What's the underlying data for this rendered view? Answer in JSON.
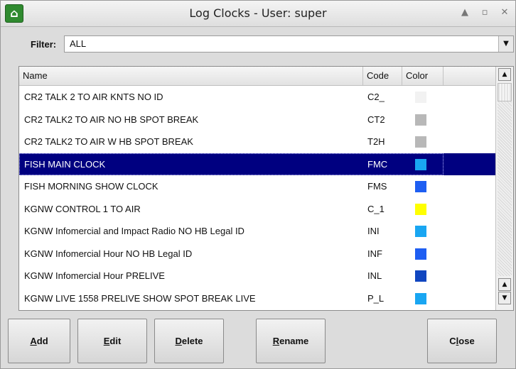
{
  "window": {
    "title": "Log Clocks - User: super"
  },
  "filter": {
    "label": "Filter:",
    "value": "ALL"
  },
  "columns": {
    "name": "Name",
    "code": "Code",
    "color": "Color"
  },
  "rows": [
    {
      "name": "CR2 TALK 2 TO AIR KNTS  NO ID",
      "code": "C2_",
      "color": "#f2f2f2"
    },
    {
      "name": "CR2 TALK2 TO AIR NO HB SPOT BREAK",
      "code": "CT2",
      "color": "#b8b8b8"
    },
    {
      "name": "CR2 TALK2 TO AIR W HB SPOT BREAK",
      "code": "T2H",
      "color": "#b8b8b8"
    },
    {
      "name": "FISH MAIN CLOCK",
      "code": "FMC",
      "color": "#19a6f2",
      "selected": true
    },
    {
      "name": "FISH MORNING SHOW CLOCK",
      "code": "FMS",
      "color": "#1e5ef2"
    },
    {
      "name": "KGNW   CONTROL 1 TO AIR",
      "code": "C_1",
      "color": "#ffff00"
    },
    {
      "name": "KGNW Infomercial and Impact Radio NO HB Legal ID",
      "code": "INI",
      "color": "#19a6f2"
    },
    {
      "name": "KGNW Infomercial Hour NO HB Legal ID",
      "code": "INF",
      "color": "#1e5ef2"
    },
    {
      "name": "KGNW Infomercial Hour PRELIVE",
      "code": "INL",
      "color": "#1046c0"
    },
    {
      "name": "KGNW LIVE  1558   PRELIVE SHOW SPOT BREAK  LIVE",
      "code": "P_L",
      "color": "#19a6f2"
    }
  ],
  "buttons": {
    "add": {
      "key": "A",
      "rest": "dd"
    },
    "edit": {
      "key": "E",
      "rest": "dit"
    },
    "delete": {
      "key": "D",
      "rest": "elete"
    },
    "rename": {
      "key": "R",
      "rest": "ename"
    },
    "close": {
      "pre": "C",
      "key": "l",
      "rest": "ose"
    }
  },
  "icons": {
    "app": "app-logo-icon",
    "minimize": "arrow-up-icon",
    "maximize": "maximize-icon",
    "close": "close-icon"
  }
}
